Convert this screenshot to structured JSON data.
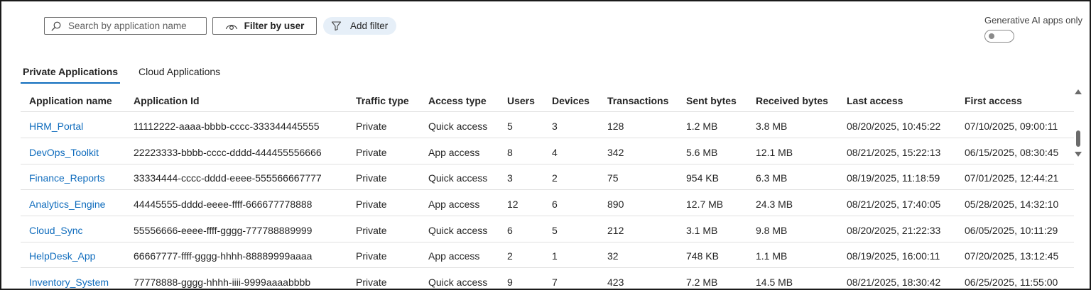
{
  "toolbar": {
    "search_placeholder": "Search by application name",
    "filter_user_label": "Filter by user",
    "add_filter_label": "Add filter",
    "gen_ai_label": "Generative AI apps only",
    "gen_ai_enabled": false
  },
  "tabs": [
    {
      "label": "Private Applications",
      "active": true
    },
    {
      "label": "Cloud Applications",
      "active": false
    }
  ],
  "table": {
    "columns": [
      "Application name",
      "Application Id",
      "Traffic type",
      "Access type",
      "Users",
      "Devices",
      "Transactions",
      "Sent bytes",
      "Received bytes",
      "Last access",
      "First access"
    ],
    "rows": [
      [
        "HRM_Portal",
        "11112222-aaaa-bbbb-cccc-333344445555",
        "Private",
        "Quick access",
        "5",
        "3",
        "128",
        "1.2 MB",
        "3.8 MB",
        "08/20/2025, 10:45:22",
        "07/10/2025, 09:00:11"
      ],
      [
        "DevOps_Toolkit",
        "22223333-bbbb-cccc-dddd-444455556666",
        "Private",
        "App access",
        "8",
        "4",
        "342",
        "5.6 MB",
        "12.1 MB",
        "08/21/2025, 15:22:13",
        "06/15/2025, 08:30:45"
      ],
      [
        "Finance_Reports",
        "33334444-cccc-dddd-eeee-555566667777",
        "Private",
        "Quick access",
        "3",
        "2",
        "75",
        "954 KB",
        "6.3 MB",
        "08/19/2025, 11:18:59",
        "07/01/2025, 12:44:21"
      ],
      [
        "Analytics_Engine",
        "44445555-dddd-eeee-ffff-666677778888",
        "Private",
        "App access",
        "12",
        "6",
        "890",
        "12.7 MB",
        "24.3 MB",
        "08/21/2025, 17:40:05",
        "05/28/2025, 14:32:10"
      ],
      [
        "Cloud_Sync",
        "55556666-eeee-ffff-gggg-777788889999",
        "Private",
        "Quick access",
        "6",
        "5",
        "212",
        "3.1 MB",
        "9.8 MB",
        "08/20/2025, 21:22:33",
        "06/05/2025, 10:11:29"
      ],
      [
        "HelpDesk_App",
        "66667777-ffff-gggg-hhhh-88889999aaaa",
        "Private",
        "App access",
        "2",
        "1",
        "32",
        "748 KB",
        "1.1 MB",
        "08/19/2025, 16:00:11",
        "07/20/2025, 13:12:45"
      ],
      [
        "Inventory_System",
        "77778888-gggg-hhhh-iiii-9999aaaabbbb",
        "Private",
        "Quick access",
        "9",
        "7",
        "423",
        "7.2 MB",
        "14.5 MB",
        "08/21/2025, 18:30:42",
        "06/25/2025, 11:55:00"
      ]
    ]
  },
  "icons": {
    "search": "search-icon",
    "filter_user": "eye-icon",
    "add_filter": "funnel-icon"
  },
  "colors": {
    "link": "#0f6cbd",
    "accent": "#0f6cbd",
    "pill_bg": "#e6eff8"
  }
}
